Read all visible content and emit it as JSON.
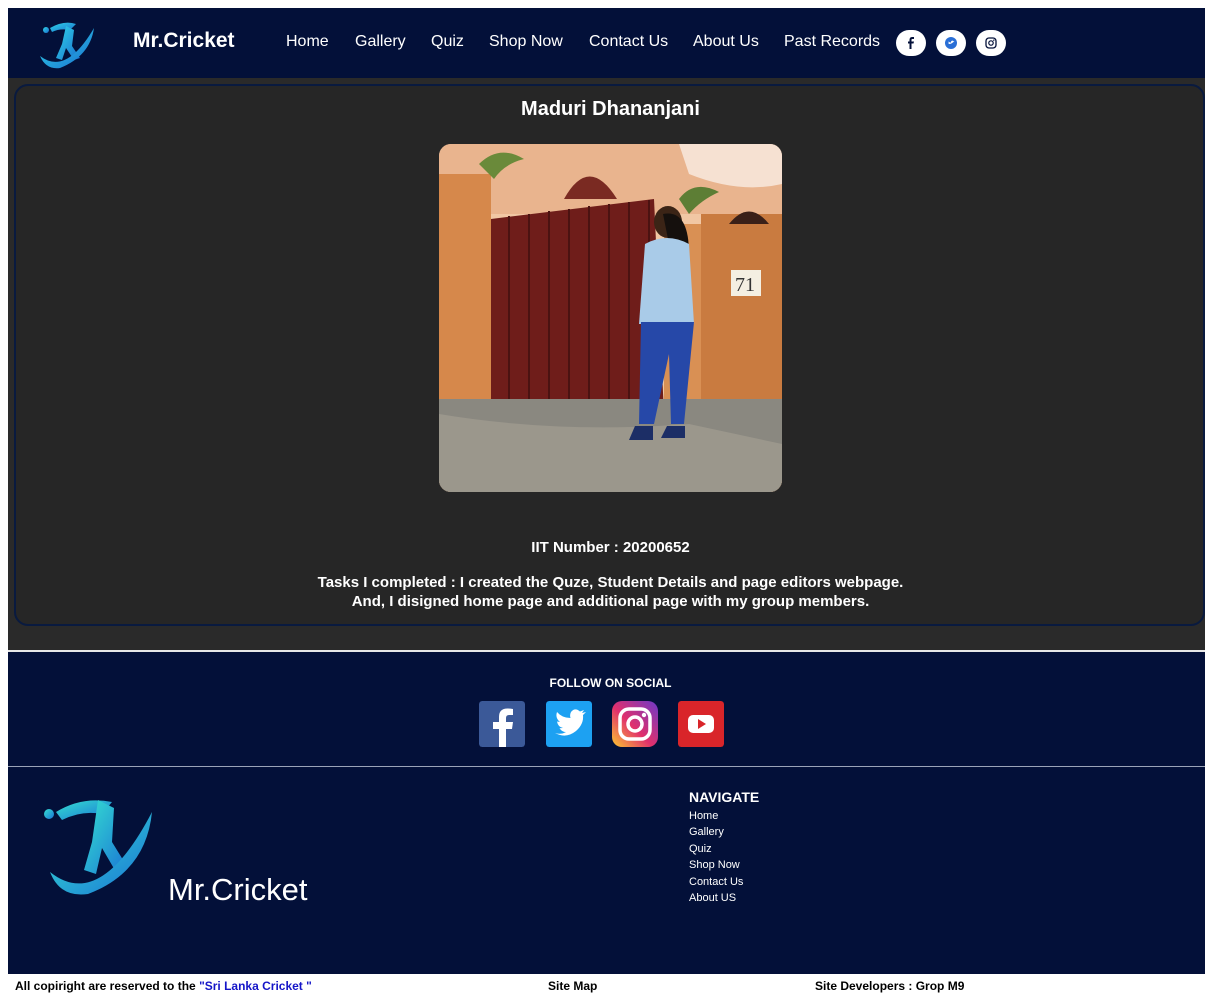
{
  "header": {
    "brand": "Mr.Cricket",
    "nav": [
      "Home",
      "Gallery",
      "Quiz",
      "Shop Now",
      "Contact Us",
      "About Us",
      "Past Records"
    ],
    "social": [
      {
        "icon": "facebook-icon",
        "glyph": "f"
      },
      {
        "icon": "twitter-icon",
        "glyph": "🐦"
      },
      {
        "icon": "instagram-icon",
        "glyph": "◎"
      }
    ]
  },
  "profile": {
    "name": "Maduri Dhananjani",
    "iit_number": "IIT Number : 20200652",
    "tasks_line1": "Tasks I completed : I created the Quze, Student Details and page editors webpage.",
    "tasks_line2": "And, I disigned home page and additional page with my group members.",
    "gate_number": "71"
  },
  "footer": {
    "follow_title": "FOLLOW ON SOCIAL",
    "social_icons": [
      "facebook-icon",
      "twitter-icon",
      "instagram-icon",
      "youtube-icon"
    ],
    "brand": "Mr.Cricket",
    "nav_title": "NAVIGATE",
    "nav_items": [
      "Home",
      "Gallery",
      "Quiz",
      "Shop Now",
      "Contact Us",
      "About US"
    ]
  },
  "bottom_bar": {
    "copyright_prefix": "All copiright are reserved to the",
    "copyright_org": "\"Sri Lanka Cricket \"",
    "site_map": "Site Map",
    "developers": "Site Developers : Grop M9"
  },
  "colors": {
    "navy": "#031039",
    "card": "#262626",
    "logo_teal": "#22b6dd",
    "link_blue": "#1515c8"
  }
}
